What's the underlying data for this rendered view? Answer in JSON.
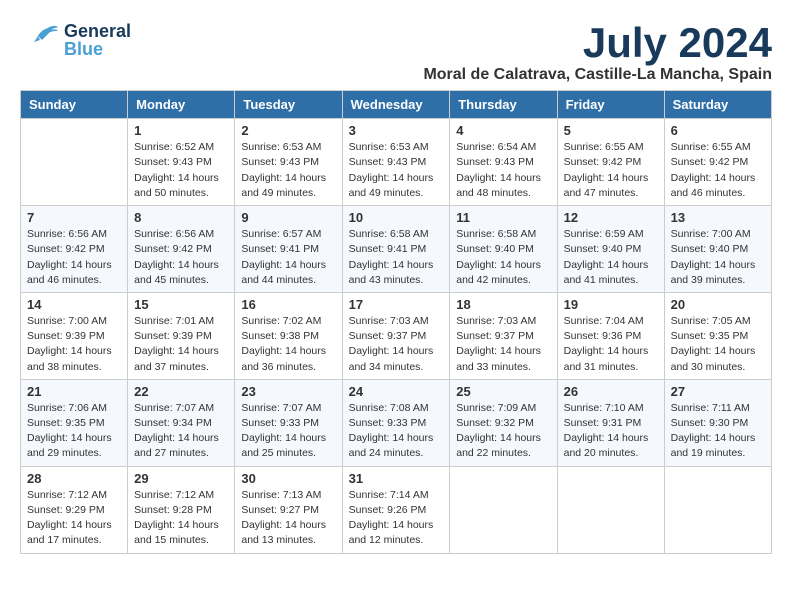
{
  "header": {
    "logo_general": "General",
    "logo_blue": "Blue",
    "month_title": "July 2024",
    "location": "Moral de Calatrava, Castille-La Mancha, Spain"
  },
  "weekdays": [
    "Sunday",
    "Monday",
    "Tuesday",
    "Wednesday",
    "Thursday",
    "Friday",
    "Saturday"
  ],
  "weeks": [
    [
      {
        "day": "",
        "info": ""
      },
      {
        "day": "1",
        "info": "Sunrise: 6:52 AM\nSunset: 9:43 PM\nDaylight: 14 hours\nand 50 minutes."
      },
      {
        "day": "2",
        "info": "Sunrise: 6:53 AM\nSunset: 9:43 PM\nDaylight: 14 hours\nand 49 minutes."
      },
      {
        "day": "3",
        "info": "Sunrise: 6:53 AM\nSunset: 9:43 PM\nDaylight: 14 hours\nand 49 minutes."
      },
      {
        "day": "4",
        "info": "Sunrise: 6:54 AM\nSunset: 9:43 PM\nDaylight: 14 hours\nand 48 minutes."
      },
      {
        "day": "5",
        "info": "Sunrise: 6:55 AM\nSunset: 9:42 PM\nDaylight: 14 hours\nand 47 minutes."
      },
      {
        "day": "6",
        "info": "Sunrise: 6:55 AM\nSunset: 9:42 PM\nDaylight: 14 hours\nand 46 minutes."
      }
    ],
    [
      {
        "day": "7",
        "info": "Sunrise: 6:56 AM\nSunset: 9:42 PM\nDaylight: 14 hours\nand 46 minutes."
      },
      {
        "day": "8",
        "info": "Sunrise: 6:56 AM\nSunset: 9:42 PM\nDaylight: 14 hours\nand 45 minutes."
      },
      {
        "day": "9",
        "info": "Sunrise: 6:57 AM\nSunset: 9:41 PM\nDaylight: 14 hours\nand 44 minutes."
      },
      {
        "day": "10",
        "info": "Sunrise: 6:58 AM\nSunset: 9:41 PM\nDaylight: 14 hours\nand 43 minutes."
      },
      {
        "day": "11",
        "info": "Sunrise: 6:58 AM\nSunset: 9:40 PM\nDaylight: 14 hours\nand 42 minutes."
      },
      {
        "day": "12",
        "info": "Sunrise: 6:59 AM\nSunset: 9:40 PM\nDaylight: 14 hours\nand 41 minutes."
      },
      {
        "day": "13",
        "info": "Sunrise: 7:00 AM\nSunset: 9:40 PM\nDaylight: 14 hours\nand 39 minutes."
      }
    ],
    [
      {
        "day": "14",
        "info": "Sunrise: 7:00 AM\nSunset: 9:39 PM\nDaylight: 14 hours\nand 38 minutes."
      },
      {
        "day": "15",
        "info": "Sunrise: 7:01 AM\nSunset: 9:39 PM\nDaylight: 14 hours\nand 37 minutes."
      },
      {
        "day": "16",
        "info": "Sunrise: 7:02 AM\nSunset: 9:38 PM\nDaylight: 14 hours\nand 36 minutes."
      },
      {
        "day": "17",
        "info": "Sunrise: 7:03 AM\nSunset: 9:37 PM\nDaylight: 14 hours\nand 34 minutes."
      },
      {
        "day": "18",
        "info": "Sunrise: 7:03 AM\nSunset: 9:37 PM\nDaylight: 14 hours\nand 33 minutes."
      },
      {
        "day": "19",
        "info": "Sunrise: 7:04 AM\nSunset: 9:36 PM\nDaylight: 14 hours\nand 31 minutes."
      },
      {
        "day": "20",
        "info": "Sunrise: 7:05 AM\nSunset: 9:35 PM\nDaylight: 14 hours\nand 30 minutes."
      }
    ],
    [
      {
        "day": "21",
        "info": "Sunrise: 7:06 AM\nSunset: 9:35 PM\nDaylight: 14 hours\nand 29 minutes."
      },
      {
        "day": "22",
        "info": "Sunrise: 7:07 AM\nSunset: 9:34 PM\nDaylight: 14 hours\nand 27 minutes."
      },
      {
        "day": "23",
        "info": "Sunrise: 7:07 AM\nSunset: 9:33 PM\nDaylight: 14 hours\nand 25 minutes."
      },
      {
        "day": "24",
        "info": "Sunrise: 7:08 AM\nSunset: 9:33 PM\nDaylight: 14 hours\nand 24 minutes."
      },
      {
        "day": "25",
        "info": "Sunrise: 7:09 AM\nSunset: 9:32 PM\nDaylight: 14 hours\nand 22 minutes."
      },
      {
        "day": "26",
        "info": "Sunrise: 7:10 AM\nSunset: 9:31 PM\nDaylight: 14 hours\nand 20 minutes."
      },
      {
        "day": "27",
        "info": "Sunrise: 7:11 AM\nSunset: 9:30 PM\nDaylight: 14 hours\nand 19 minutes."
      }
    ],
    [
      {
        "day": "28",
        "info": "Sunrise: 7:12 AM\nSunset: 9:29 PM\nDaylight: 14 hours\nand 17 minutes."
      },
      {
        "day": "29",
        "info": "Sunrise: 7:12 AM\nSunset: 9:28 PM\nDaylight: 14 hours\nand 15 minutes."
      },
      {
        "day": "30",
        "info": "Sunrise: 7:13 AM\nSunset: 9:27 PM\nDaylight: 14 hours\nand 13 minutes."
      },
      {
        "day": "31",
        "info": "Sunrise: 7:14 AM\nSunset: 9:26 PM\nDaylight: 14 hours\nand 12 minutes."
      },
      {
        "day": "",
        "info": ""
      },
      {
        "day": "",
        "info": ""
      },
      {
        "day": "",
        "info": ""
      }
    ]
  ]
}
